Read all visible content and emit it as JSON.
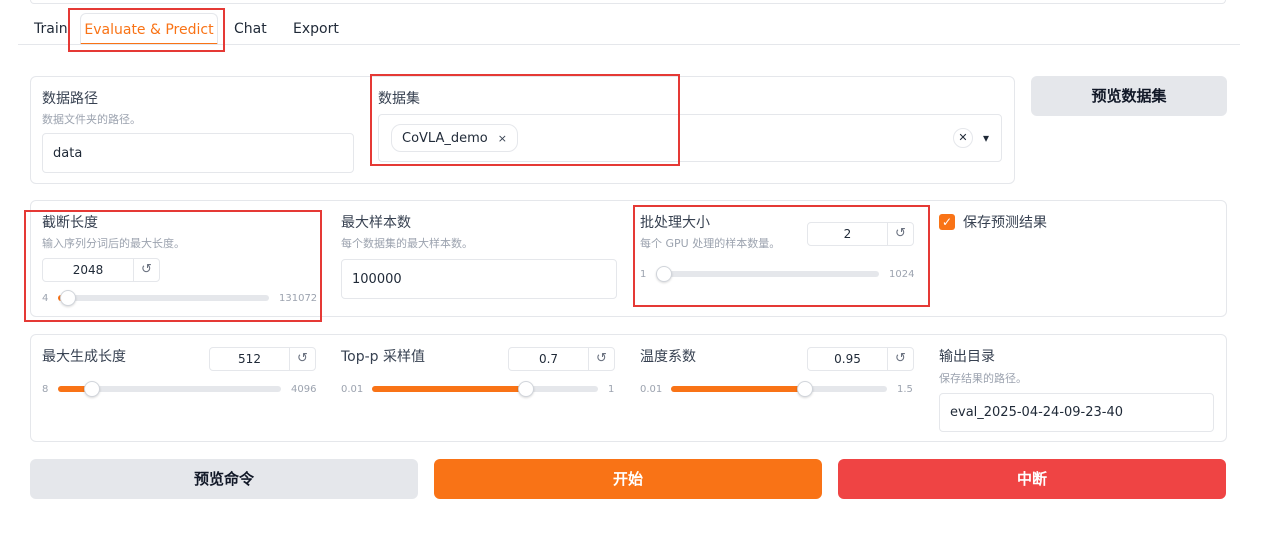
{
  "tabs": [
    {
      "label": "Train"
    },
    {
      "label": "Evaluate & Predict"
    },
    {
      "label": "Chat"
    },
    {
      "label": "Export"
    }
  ],
  "data_dir": {
    "label": "数据路径",
    "info": "数据文件夹的路径。",
    "value": "data"
  },
  "dataset": {
    "label": "数据集",
    "chips": [
      "CoVLA_demo"
    ],
    "chip_remove": "×",
    "clear": "✕",
    "dropdown": "▾"
  },
  "preview_dataset_button": "预览数据集",
  "cutoff_len": {
    "label": "截断长度",
    "info": "输入序列分词后的最大长度。",
    "value": "2048",
    "min": "4",
    "max": "131072",
    "fraction": 0.0002
  },
  "max_samples": {
    "label": "最大样本数",
    "info": "每个数据集的最大样本数。",
    "value": "100000"
  },
  "batch_size": {
    "label": "批处理大小",
    "info": "每个 GPU 处理的样本数量。",
    "value": "2",
    "min": "1",
    "max": "1024",
    "fraction": 0.001
  },
  "predict": {
    "label": "保存预测结果",
    "checked": true,
    "check": "✓"
  },
  "max_new_tokens": {
    "label": "最大生成长度",
    "value": "512",
    "min": "8",
    "max": "4096",
    "fraction": 0.123
  },
  "top_p": {
    "label": "Top-p 采样值",
    "value": "0.7",
    "min": "0.01",
    "max": "1",
    "fraction": 0.697
  },
  "temperature": {
    "label": "温度系数",
    "value": "0.95",
    "min": "0.01",
    "max": "1.5",
    "fraction": 0.631
  },
  "output_dir": {
    "label": "输出目录",
    "info": "保存结果的路径。",
    "value": "eval_2025-04-24-09-23-40"
  },
  "reset_icon": "↺",
  "actions": {
    "preview_command": "预览命令",
    "start": "开始",
    "abort": "中断"
  },
  "colors": {
    "accent": "#f97316",
    "abort": "#ef4444",
    "highlight": "#e53935"
  }
}
